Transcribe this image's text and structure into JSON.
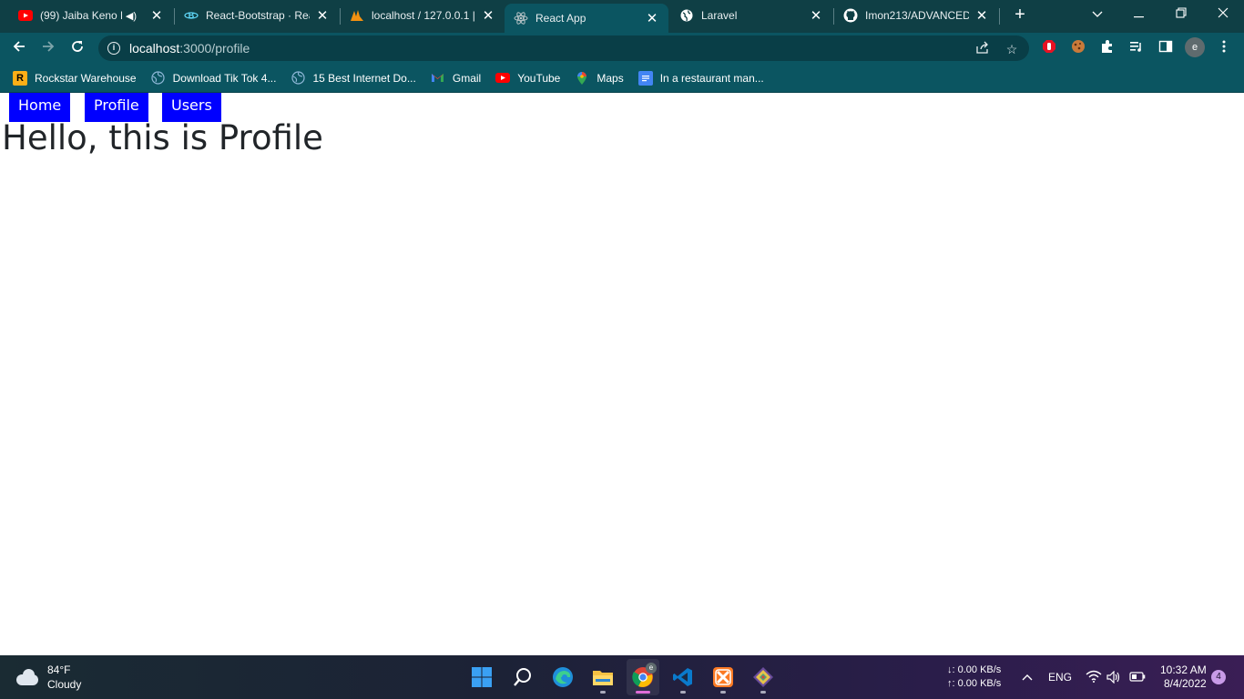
{
  "browser": {
    "tabs": [
      {
        "title": "(99) Jaiba Keno Bo",
        "icon": "youtube-icon",
        "audio": true
      },
      {
        "title": "React-Bootstrap · Reac",
        "icon": "react-bootstrap-icon"
      },
      {
        "title": "localhost / 127.0.0.1 | p",
        "icon": "phpmyadmin-icon"
      },
      {
        "title": "React App",
        "icon": "react-icon",
        "active": true
      },
      {
        "title": "Laravel",
        "icon": "globe-icon"
      },
      {
        "title": "Imon213/ADVANCED-",
        "icon": "github-icon"
      }
    ],
    "address": {
      "host": "localhost",
      "path": ":3000/profile"
    },
    "bookmarks": [
      {
        "label": "Rockstar Warehouse",
        "icon": "rockstar-icon"
      },
      {
        "label": "Download Tik Tok 4...",
        "icon": "globe-icon"
      },
      {
        "label": "15 Best Internet Do...",
        "icon": "globe-icon"
      },
      {
        "label": "Gmail",
        "icon": "gmail-icon"
      },
      {
        "label": "YouTube",
        "icon": "youtube-icon"
      },
      {
        "label": "Maps",
        "icon": "maps-icon"
      },
      {
        "label": "In a restaurant man...",
        "icon": "docs-icon"
      }
    ],
    "profile_initial": "e"
  },
  "page": {
    "nav": {
      "home": "Home",
      "profile": "Profile",
      "users": "Users"
    },
    "heading": "Hello, this is Profile"
  },
  "taskbar": {
    "weather": {
      "temp": "84°F",
      "condition": "Cloudy"
    },
    "network": {
      "down": "↓: 0.00 KB/s",
      "up": "↑: 0.00 KB/s"
    },
    "language": "ENG",
    "time": "10:32 AM",
    "date": "8/4/2022",
    "notifications": "4"
  },
  "colors": {
    "tabstrip": "#0f3f45",
    "toolbar": "#0b5561",
    "nav_link_bg": "#0000ff"
  }
}
